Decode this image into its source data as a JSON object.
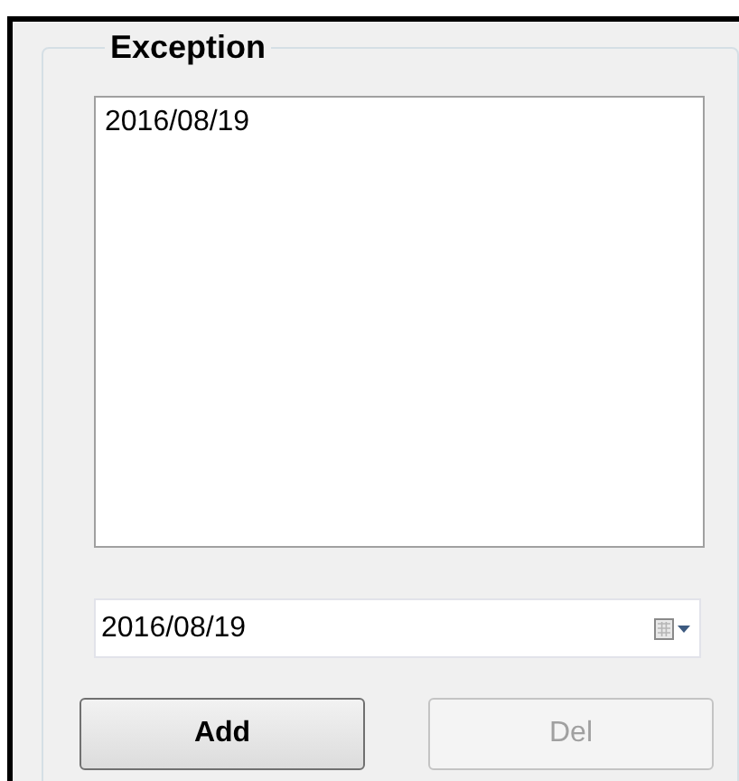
{
  "group": {
    "title": "Exception"
  },
  "list": {
    "items": [
      "2016/08/19"
    ]
  },
  "date_field": {
    "value": "2016/08/19"
  },
  "buttons": [
    {
      "label": "Add",
      "disabled": false
    },
    {
      "label": "Del",
      "disabled": true
    }
  ]
}
